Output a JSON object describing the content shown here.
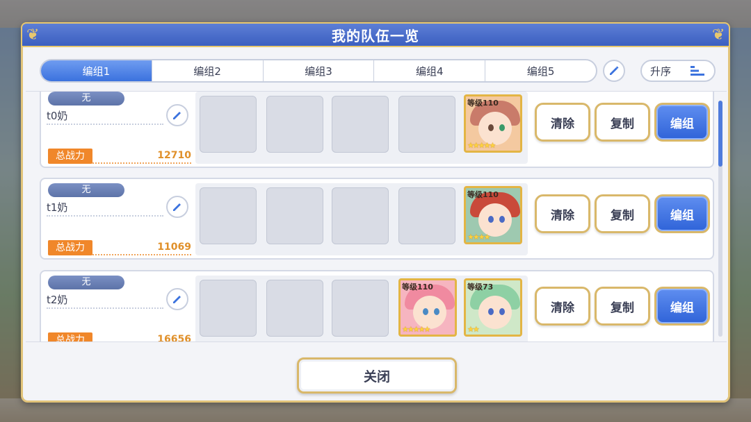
{
  "dialog": {
    "title": "我的队伍一览"
  },
  "tabs": [
    {
      "label": "编组1",
      "active": true
    },
    {
      "label": "编组2",
      "active": false
    },
    {
      "label": "编组3",
      "active": false
    },
    {
      "label": "编组4",
      "active": false
    },
    {
      "label": "编组5",
      "active": false
    }
  ],
  "sort": {
    "label": "升序"
  },
  "power_label": "总战力",
  "buttons": {
    "clear": "清除",
    "copy": "复制",
    "edit": "编组",
    "close": "关闭"
  },
  "teams": [
    {
      "badge": "无",
      "name": "t0奶",
      "power": "12710",
      "characters": [
        {
          "level": "等级110",
          "stars": "★★★★★"
        }
      ]
    },
    {
      "badge": "无",
      "name": "t1奶",
      "power": "11069",
      "characters": [
        {
          "level": "等级110",
          "stars": "★★★★"
        }
      ]
    },
    {
      "badge": "无",
      "name": "t2奶",
      "power": "16656",
      "characters": [
        {
          "level": "等级110",
          "stars": "★★★★★"
        },
        {
          "level": "等级73",
          "stars": "★★"
        }
      ]
    }
  ],
  "colors": {
    "accent": "#3b72de",
    "gold_border": "#e2c47a",
    "power": "#f0872a"
  },
  "icons": {
    "edit": "pencil-icon",
    "sort": "sort-lines-icon"
  }
}
